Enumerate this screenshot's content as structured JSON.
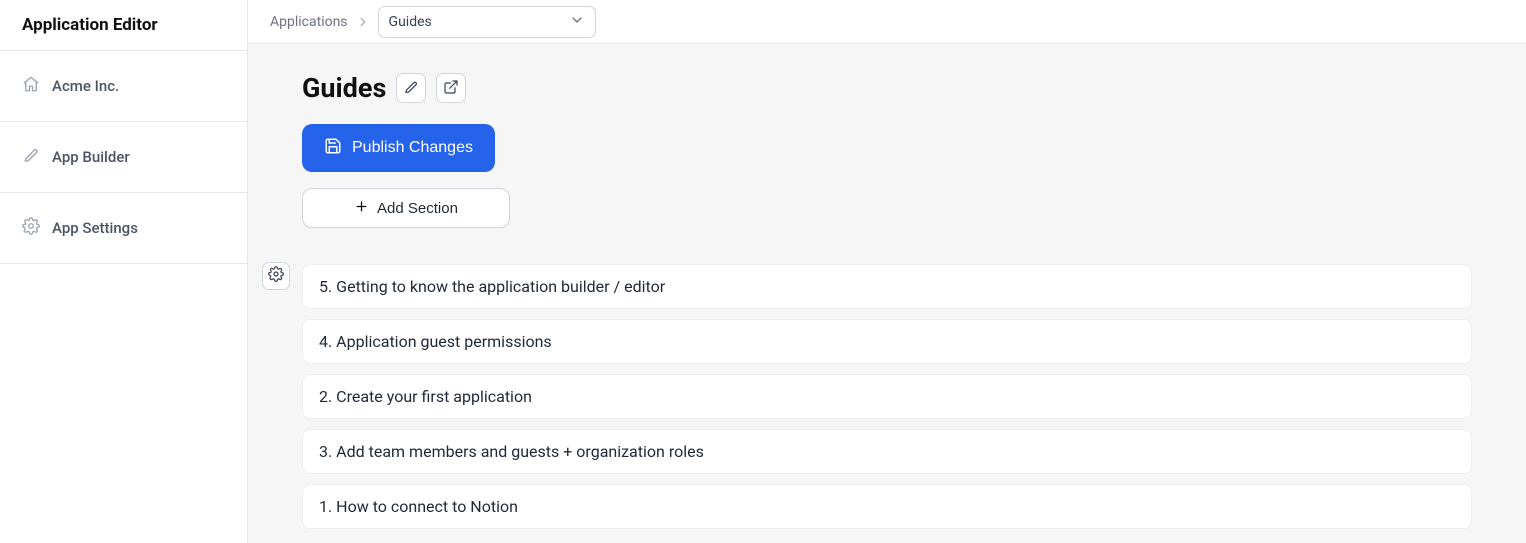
{
  "sidebar": {
    "title": "Application Editor",
    "items": [
      {
        "label": "Acme Inc.",
        "icon": "home"
      },
      {
        "label": "App Builder",
        "icon": "pencil"
      },
      {
        "label": "App Settings",
        "icon": "gear"
      }
    ]
  },
  "breadcrumb": {
    "parent": "Applications",
    "selected": "Guides"
  },
  "page": {
    "title": "Guides",
    "publish_label": "Publish Changes",
    "add_section_label": "Add Section"
  },
  "sections": [
    {
      "label": "5. Getting to know the application builder / editor"
    },
    {
      "label": "4. Application guest permissions"
    },
    {
      "label": "2. Create your first application"
    },
    {
      "label": "3. Add team members and guests + organization roles"
    },
    {
      "label": "1. How to connect to Notion"
    }
  ]
}
